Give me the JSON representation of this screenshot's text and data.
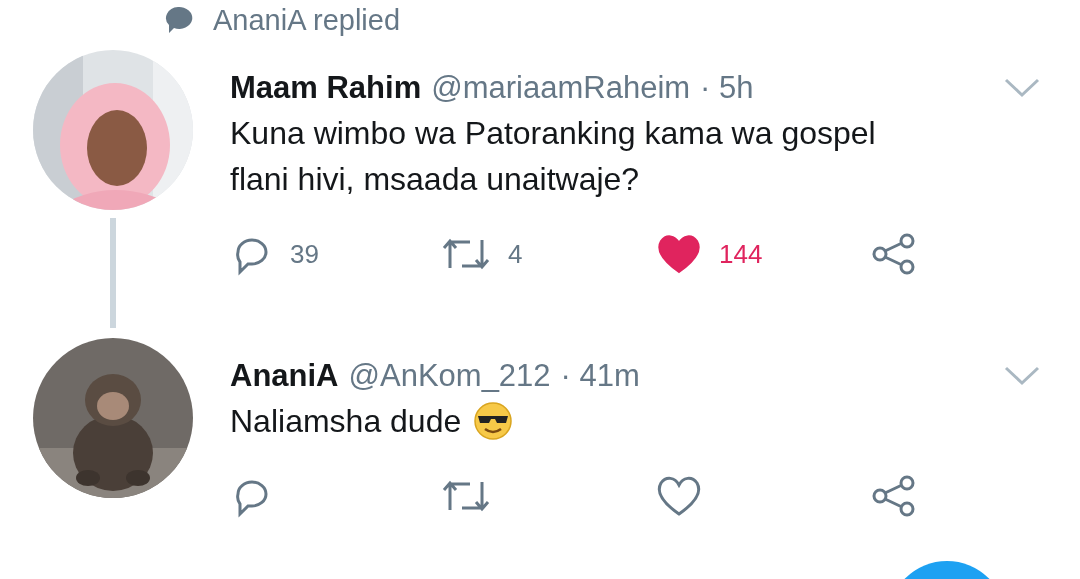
{
  "context": {
    "text": "AnaniA replied"
  },
  "tweets": [
    {
      "name": "Maam Rahim",
      "handle": "@mariaamRaheim",
      "time": "· 5h",
      "text_lines": [
        "Kuna wimbo wa Patoranking kama wa gospel",
        "flani hivi, msaada unaitwaje?"
      ],
      "emoji": false,
      "thread_line": true,
      "liked": true,
      "reply_count": "39",
      "retweet_count": "4",
      "like_count": "144"
    },
    {
      "name": "AnaniA",
      "handle": "@AnKom_212",
      "time": "· 41m",
      "text_lines": [
        "Naliamsha dude"
      ],
      "emoji": true,
      "thread_line": false,
      "liked": false
    }
  ]
}
